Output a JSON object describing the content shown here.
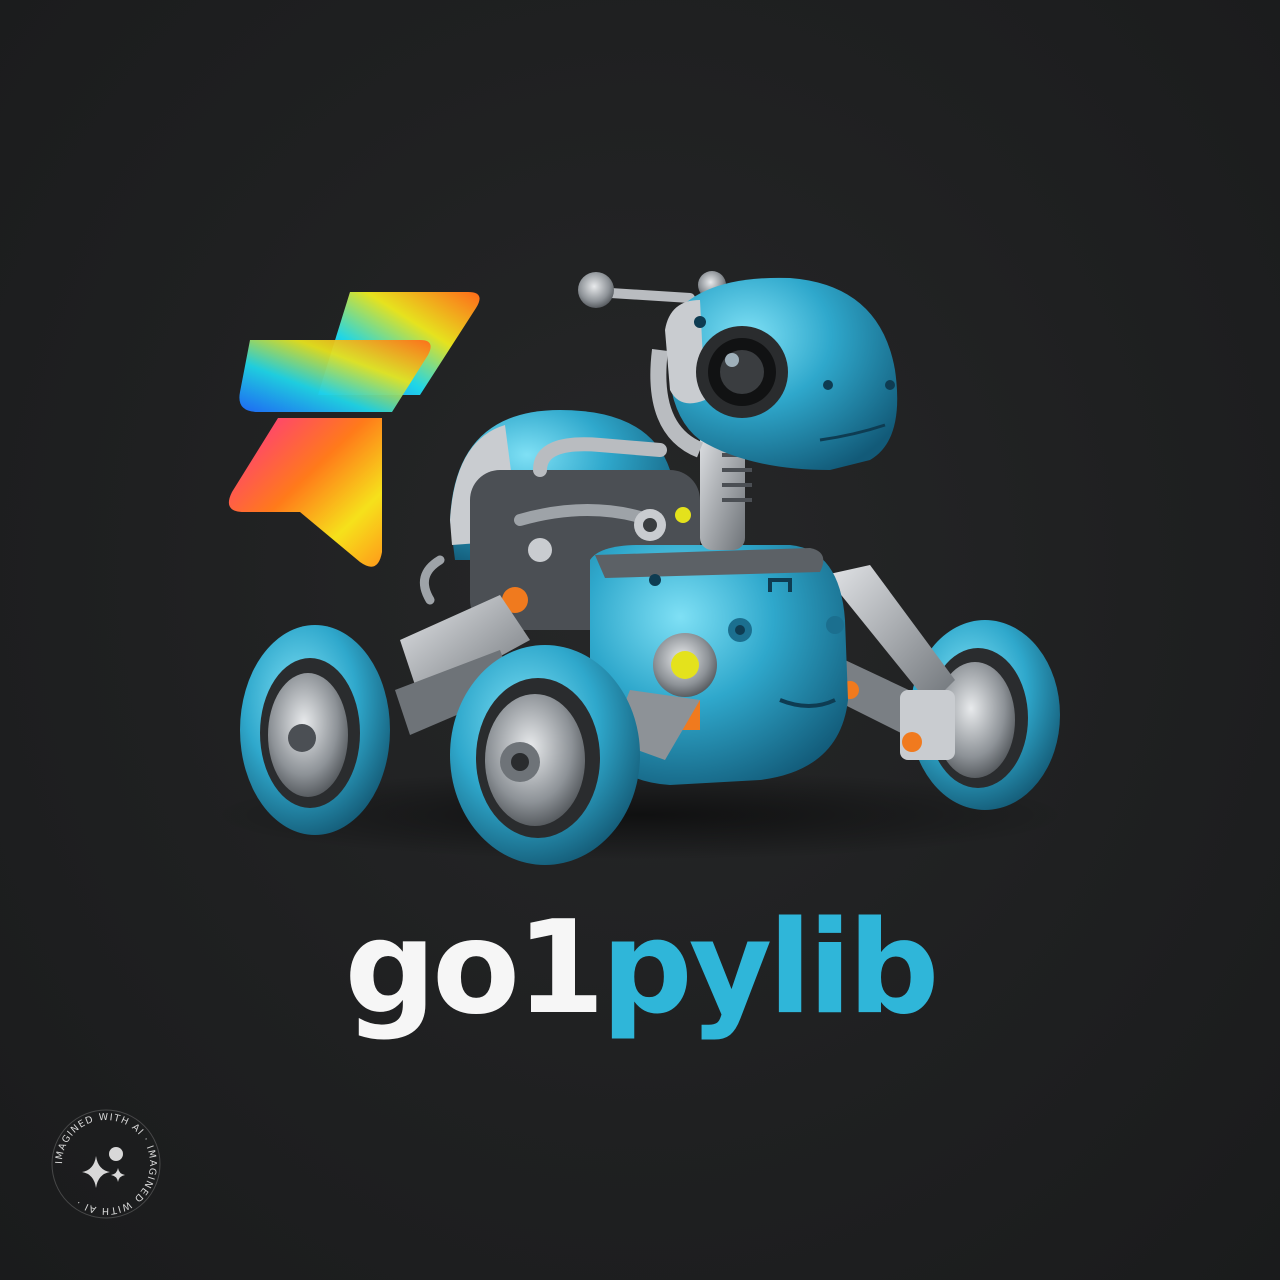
{
  "colors": {
    "background": "#1e1f20",
    "robot_body": "#2fa8cc",
    "robot_metal": "#b9bcc0",
    "accent_orange": "#f07a1e",
    "wordmark_white": "#f6f6f6",
    "wordmark_blue": "#2fb6d9"
  },
  "wordmark": {
    "part_white": "go1",
    "part_blue": "pylib"
  },
  "badge": {
    "ring_text": "IMAGINED WITH AI · IMAGINED WITH AI ·",
    "icon": "sparkle-icon"
  },
  "logo_mark": {
    "icon": "gradient-chevron-logo-icon"
  }
}
